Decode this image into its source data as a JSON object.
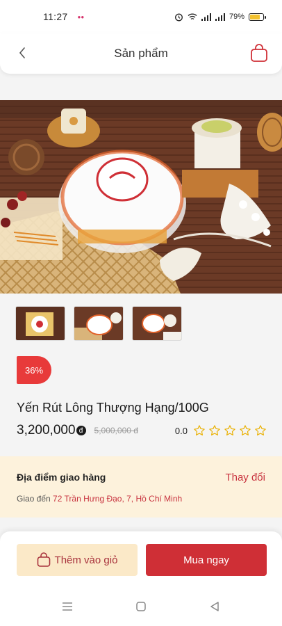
{
  "status_bar": {
    "time": "11:27",
    "battery": "79%",
    "battery_level": 0.79
  },
  "header": {
    "title": "Sản phẩm"
  },
  "product": {
    "discount": "36%",
    "name": "Yến Rút Lông Thượng Hạng/100G",
    "price": "3,200,000",
    "currency_symbol": "đ",
    "old_price": "5,000,000 đ",
    "rating": "0.0",
    "stars": 0,
    "stars_max": 5
  },
  "delivery": {
    "title": "Địa điểm giao hàng",
    "change": "Thay đổi",
    "prefix": "Giao đến",
    "address": "72 Trần Hưng Đạo, 7, Hồ Chí Minh"
  },
  "actions": {
    "add_to_cart": "Thêm vào giỏ",
    "buy_now": "Mua ngay"
  },
  "colors": {
    "accent": "#cf2f36",
    "cream": "#fdf2dc",
    "badge": "#e83a3a"
  }
}
